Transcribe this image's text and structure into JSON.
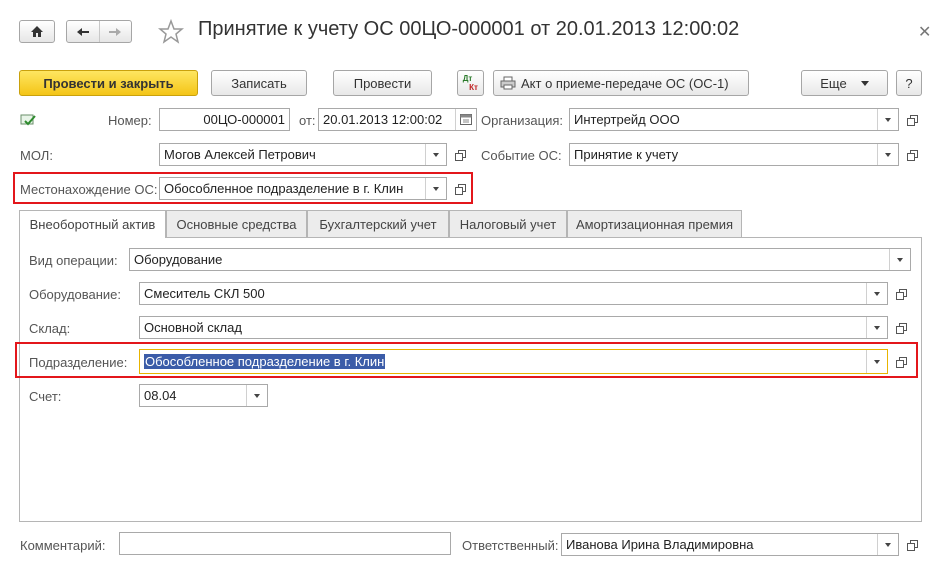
{
  "window": {
    "title": "Принятие к учету ОС 00ЦО-000001 от 20.01.2013 12:00:02",
    "icons": {
      "home": "home-icon",
      "back": "arrow-left-icon",
      "forward": "arrow-right-icon",
      "favorite": "star-icon",
      "close": "close-icon"
    }
  },
  "toolbar": {
    "post_and_close": "Провести и закрыть",
    "save": "Записать",
    "post": "Провести",
    "dt_kt_top": "Дт",
    "dt_kt_bottom": "Кт",
    "act_report": "Акт о приеме-передаче ОС (ОС-1)",
    "more": "Еще",
    "help": "?"
  },
  "header": {
    "number_label": "Номер:",
    "number_value": "00ЦО-000001",
    "from_label": "от:",
    "date_value": "20.01.2013 12:00:02",
    "org_label": "Организация:",
    "org_value": "Интертрейд ООО",
    "mol_label": "МОЛ:",
    "mol_value": "Могов Алексей Петрович",
    "event_label": "Событие ОС:",
    "event_value": "Принятие к учету",
    "location_label": "Местонахождение ОС:",
    "location_value": "Обособленное подразделение в г. Клин"
  },
  "tabs": [
    {
      "label": "Внеоборотный актив",
      "active": true
    },
    {
      "label": "Основные средства",
      "active": false
    },
    {
      "label": "Бухгалтерский учет",
      "active": false
    },
    {
      "label": "Налоговый учет",
      "active": false
    },
    {
      "label": "Амортизационная премия",
      "active": false
    }
  ],
  "asset_tab": {
    "operation_label": "Вид операции:",
    "operation_value": "Оборудование",
    "equipment_label": "Оборудование:",
    "equipment_value": "Смеситель СКЛ 500",
    "warehouse_label": "Склад:",
    "warehouse_value": "Основной склад",
    "department_label": "Подразделение:",
    "department_value": "Обособленное подразделение в г. Клин",
    "account_label": "Счет:",
    "account_value": "08.04"
  },
  "footer": {
    "comment_label": "Комментарий:",
    "comment_value": "",
    "responsible_label": "Ответственный:",
    "responsible_value": "Иванова Ирина Владимировна"
  },
  "colors": {
    "primary_button": "#f4c517",
    "highlight_box": "#e3161b",
    "selection": "#3b5ca8",
    "focus_border": "#e8b400"
  }
}
